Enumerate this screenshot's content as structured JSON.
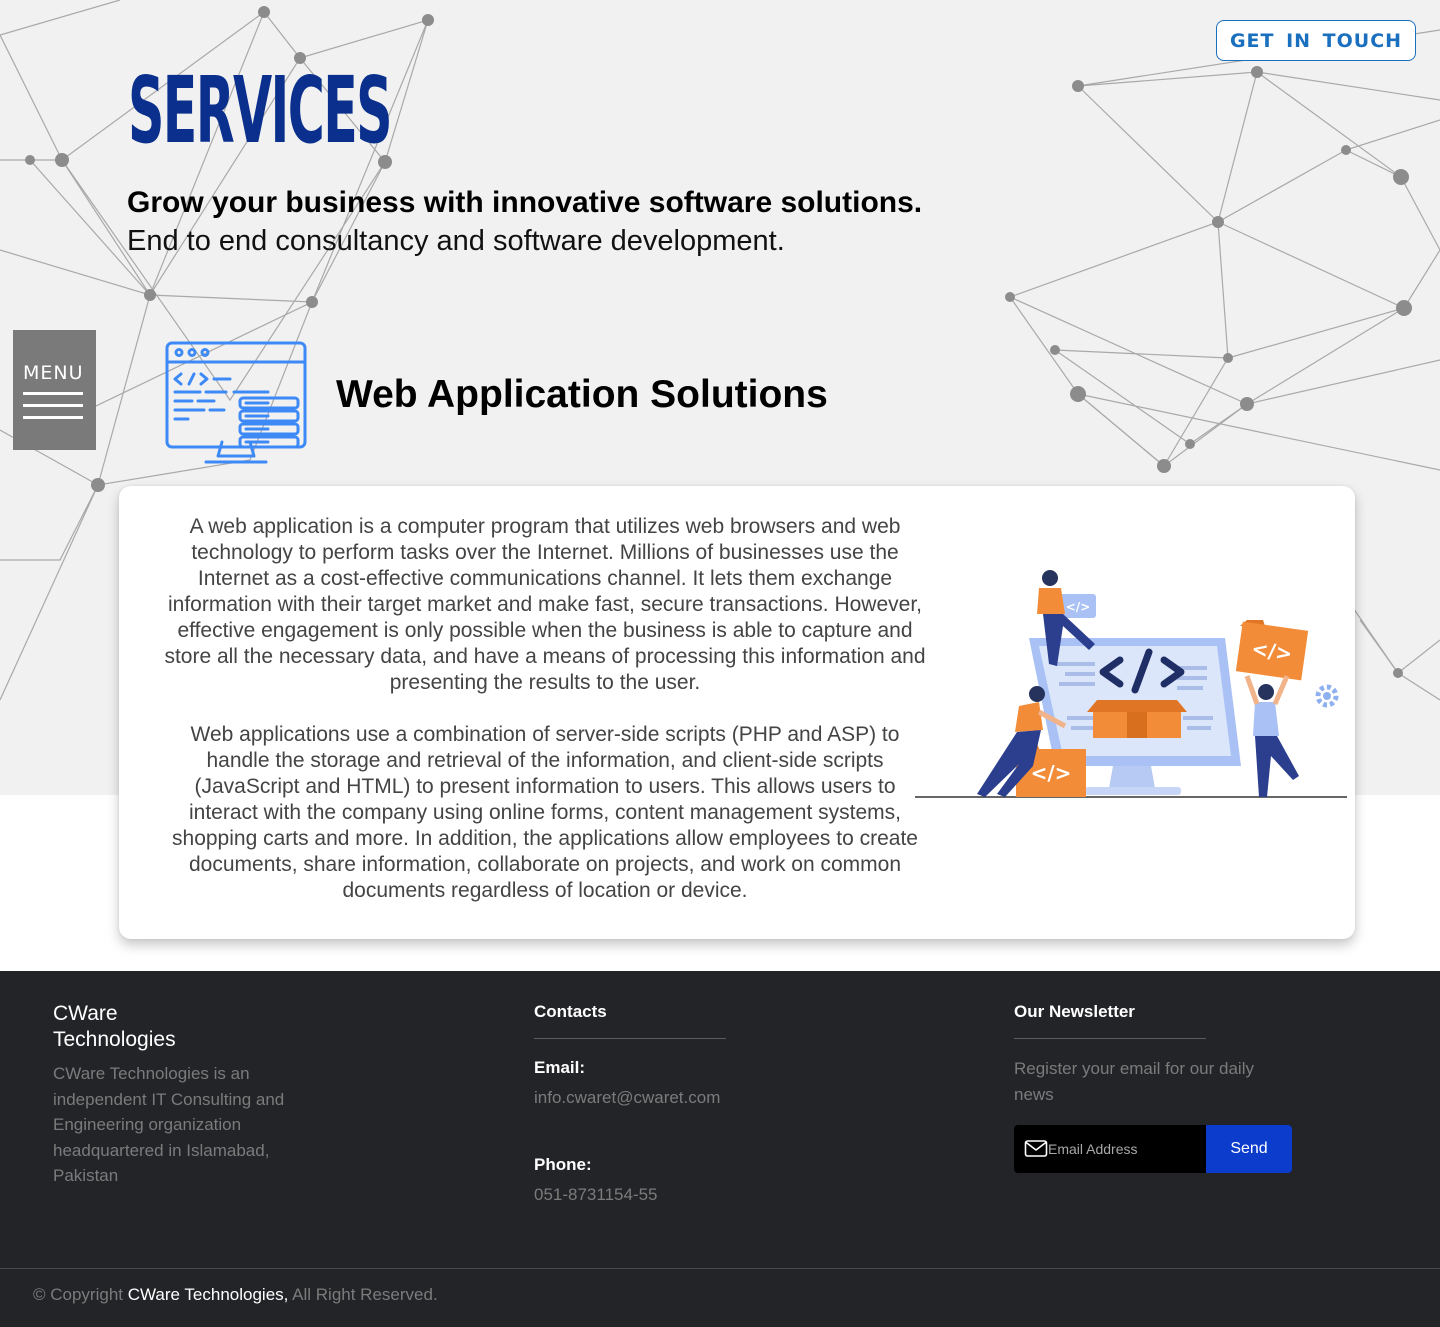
{
  "header": {
    "cta_label": "GET IN TOUCH",
    "page_title": "SERVICES",
    "tagline": "Grow your business with innovative software solutions.",
    "subline": "End to end consultancy and software development."
  },
  "menu": {
    "label": "MENU",
    "icon": "hamburger-icon"
  },
  "section": {
    "icon": "web-app-icon",
    "title": "Web Application Solutions",
    "paragraphs": [
      "A web application is a computer program that utilizes web browsers and web technology to perform tasks over the Internet. Millions of businesses use the Internet as a cost-effective communications channel. It lets them exchange information with their target market and make fast, secure transactions. However, effective engagement is only possible when the business is able to capture and store all the necessary data, and have a means of processing this information and presenting the results to the user.",
      "Web applications use a combination of server-side scripts (PHP and ASP) to handle the storage and retrieval of the information, and client-side scripts (JavaScript and HTML) to present information to users. This allows users to interact with the company using online forms, content management systems, shopping carts and more. In addition, the applications allow employees to create documents, share information, collaborate on projects, and work on common documents regardless of location or device."
    ],
    "illustration_labels": [
      "</>",
      "</>",
      "</>",
      "</>"
    ]
  },
  "footer": {
    "brand_line1": "CWare",
    "brand_line2": "Technologies",
    "description": "CWare Technologies is an independent IT Consulting and Engineering organization headquartered in Islamabad, Pakistan",
    "contacts": {
      "heading": "Contacts",
      "email_label": "Email:",
      "email_value": "info.cwaret@cwaret.com",
      "phone_label": "Phone:",
      "phone_value": "051-8731154-55"
    },
    "newsletter": {
      "heading": "Our Newsletter",
      "description": "Register your email for our daily news",
      "input_placeholder": "Email Address",
      "send_label": "Send"
    },
    "copyright_prefix": "© Copyright ",
    "copyright_brand": "CWare Technologies,",
    "copyright_suffix": " All Right Reserved."
  },
  "colors": {
    "brand_blue": "#0a2f8c",
    "cta_blue": "#1a6fbf",
    "send_blue": "#0c3ccc",
    "footer_bg": "#232427",
    "accent_orange": "#f28c38"
  }
}
